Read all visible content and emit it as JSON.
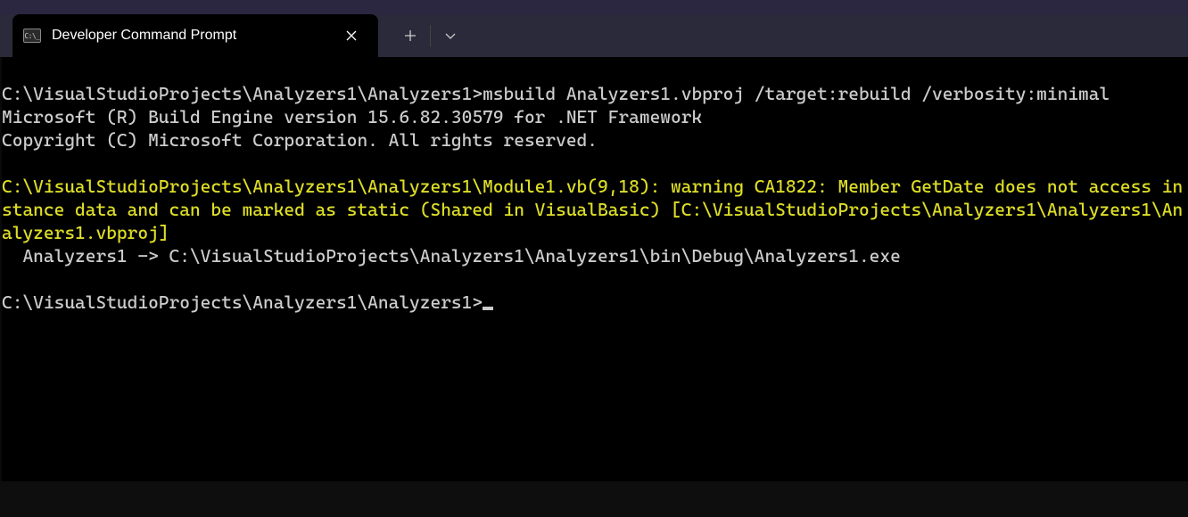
{
  "tab": {
    "title": "Developer Command Prompt",
    "icon_label": "C:\\_"
  },
  "terminal": {
    "prompt1_path": "C:\\VisualStudioProjects\\Analyzers1\\Analyzers1>",
    "command": "msbuild Analyzers1.vbproj /target:rebuild /verbosity:minimal",
    "engine_line": "Microsoft (R) Build Engine version 15.6.82.30579 for .NET Framework",
    "copyright_line": "Copyright (C) Microsoft Corporation. All rights reserved.",
    "warning_text": "C:\\VisualStudioProjects\\Analyzers1\\Analyzers1\\Module1.vb(9,18): warning CA1822: Member GetDate does not access instance data and can be marked as static (Shared in VisualBasic) [C:\\VisualStudioProjects\\Analyzers1\\Analyzers1\\Analyzers1.vbproj]",
    "output_line": "  Analyzers1 -> C:\\VisualStudioProjects\\Analyzers1\\Analyzers1\\bin\\Debug\\Analyzers1.exe",
    "prompt2_path": "C:\\VisualStudioProjects\\Analyzers1\\Analyzers1>"
  }
}
